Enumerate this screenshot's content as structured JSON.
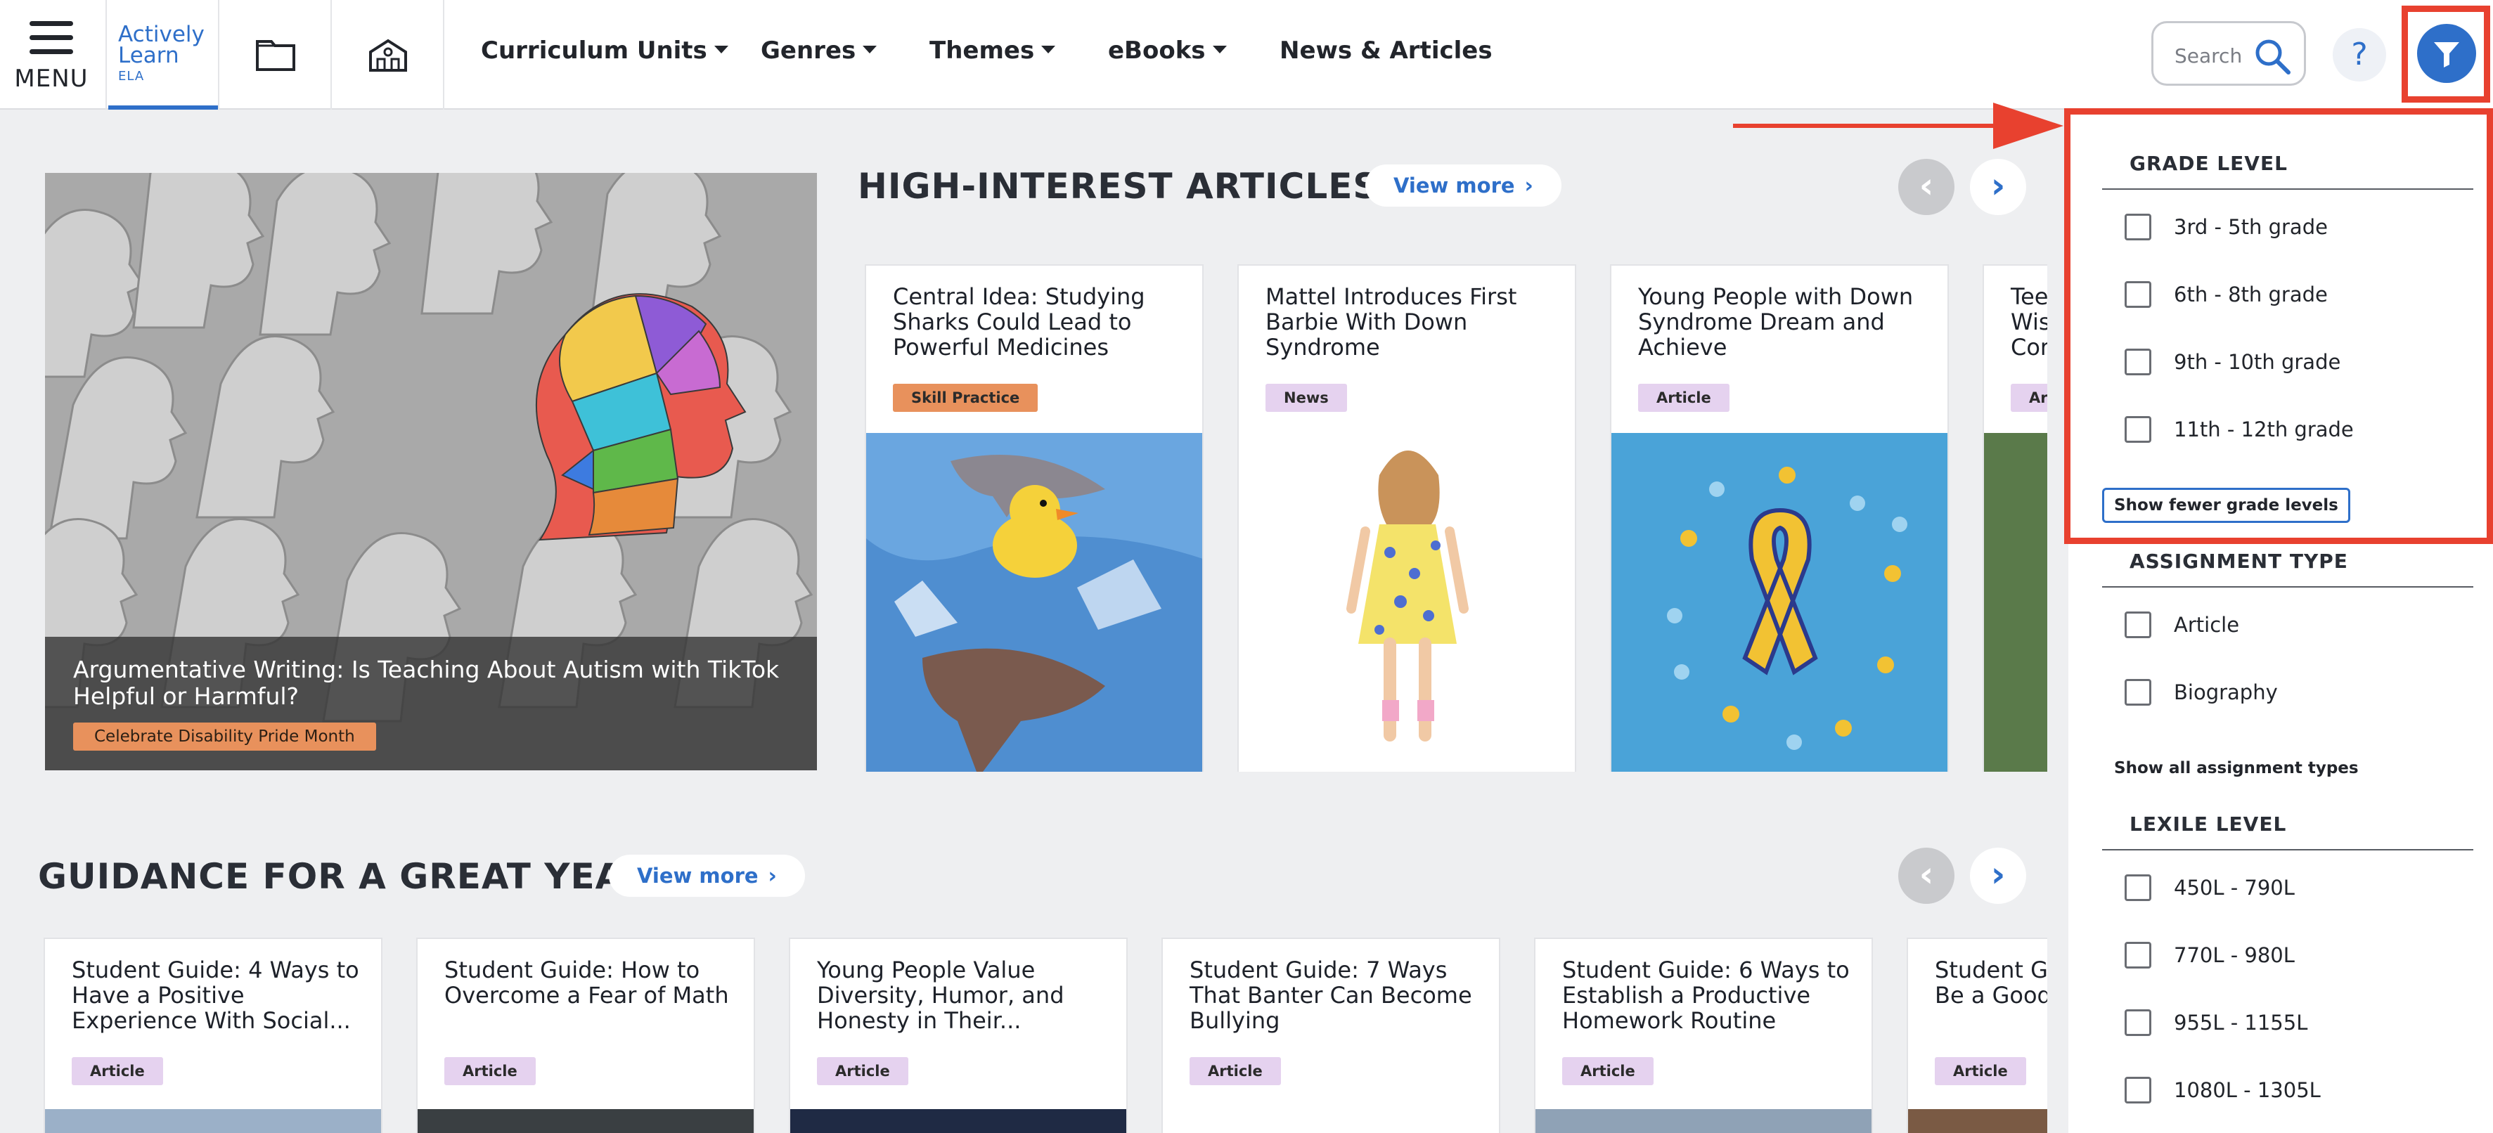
{
  "nav": {
    "menu_label": "MENU",
    "logo_line1": "Actively",
    "logo_line2": "Learn",
    "logo_sub": "ELA",
    "items": [
      {
        "label": "Curriculum Units",
        "dropdown": true
      },
      {
        "label": "Genres",
        "dropdown": true
      },
      {
        "label": "Themes",
        "dropdown": true
      },
      {
        "label": "eBooks",
        "dropdown": true
      },
      {
        "label": "News & Articles",
        "dropdown": false
      }
    ],
    "search_placeholder": "Search",
    "help_label": "?",
    "accent_color": "#2e6fc9"
  },
  "hero": {
    "title": "Argumentative Writing: Is Teaching About Autism with TikTok Helpful or Harmful?",
    "tag": "Celebrate Disability Pride Month"
  },
  "section1": {
    "title": "HIGH-INTEREST ARTICLES",
    "view_more": "View more",
    "cards": [
      {
        "title": "Central Idea: Studying Sharks Could Lead to Powerful Medicines",
        "tag": "Skill Practice",
        "tag_style": "skill"
      },
      {
        "title": "Mattel Introduces First Barbie With Down Syndrome",
        "tag": "News",
        "tag_style": "news"
      },
      {
        "title": "Young People with Down Syndrome Dream and Achieve",
        "tag": "Article",
        "tag_style": "article"
      },
      {
        "title": "Tee\nWis\nCor",
        "tag": "Ar",
        "tag_style": "article"
      }
    ]
  },
  "section2": {
    "title": "GUIDANCE FOR A GREAT YEAR",
    "view_more": "View more",
    "cards": [
      {
        "title": "Student Guide: 4 Ways to Have a Positive Experience With Social...",
        "tag": "Article"
      },
      {
        "title": "Student Guide: How to Overcome a Fear of Math",
        "tag": "Article"
      },
      {
        "title": "Young People Value Diversity, Humor, and Honesty in Their...",
        "tag": "Article"
      },
      {
        "title": "Student Guide: 7 Ways That Banter Can Become Bullying",
        "tag": "Article"
      },
      {
        "title": "Student Guide: 6 Ways to Establish a Productive Homework Routine",
        "tag": "Article"
      },
      {
        "title": "Student G\nBe a Good",
        "tag": "Article"
      }
    ]
  },
  "filters": {
    "grade": {
      "heading": "GRADE LEVEL",
      "options": [
        "3rd - 5th grade",
        "6th - 8th grade",
        "9th - 10th grade",
        "11th - 12th grade"
      ],
      "toggle": "Show fewer grade levels"
    },
    "assignment": {
      "heading": "ASSIGNMENT TYPE",
      "options": [
        "Article",
        "Biography"
      ],
      "toggle": "Show all assignment types"
    },
    "lexile": {
      "heading": "LEXILE LEVEL",
      "options": [
        "450L - 790L",
        "770L - 980L",
        "955L - 1155L",
        "1080L - 1305L"
      ]
    },
    "highlight_color": "#e8412f"
  }
}
